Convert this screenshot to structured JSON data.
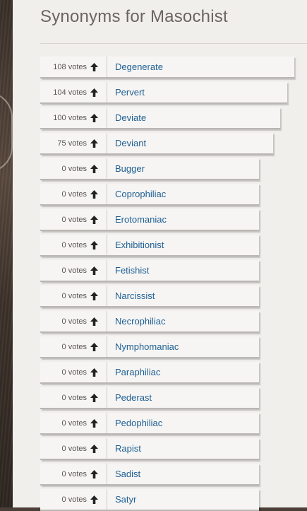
{
  "page": {
    "title": "Synonyms for Masochist"
  },
  "synonyms": [
    {
      "votes": "108 votes",
      "word": "Degenerate"
    },
    {
      "votes": "104 votes",
      "word": "Pervert"
    },
    {
      "votes": "100 votes",
      "word": "Deviate"
    },
    {
      "votes": "75 votes",
      "word": "Deviant"
    },
    {
      "votes": "0 votes",
      "word": "Bugger"
    },
    {
      "votes": "0 votes",
      "word": "Coprophiliac"
    },
    {
      "votes": "0 votes",
      "word": "Erotomaniac"
    },
    {
      "votes": "0 votes",
      "word": "Exhibitionist"
    },
    {
      "votes": "0 votes",
      "word": "Fetishist"
    },
    {
      "votes": "0 votes",
      "word": "Narcissist"
    },
    {
      "votes": "0 votes",
      "word": "Necrophiliac"
    },
    {
      "votes": "0 votes",
      "word": "Nymphomaniac"
    },
    {
      "votes": "0 votes",
      "word": "Paraphiliac"
    },
    {
      "votes": "0 votes",
      "word": "Pederast"
    },
    {
      "votes": "0 votes",
      "word": "Pedophiliac"
    },
    {
      "votes": "0 votes",
      "word": "Rapist"
    },
    {
      "votes": "0 votes",
      "word": "Sadist"
    },
    {
      "votes": "0 votes",
      "word": "Satyr"
    }
  ],
  "icons": {
    "upvote": "upvote-arrow-icon"
  },
  "colors": {
    "link": "#1f5f94",
    "panel": "#f1efec"
  }
}
